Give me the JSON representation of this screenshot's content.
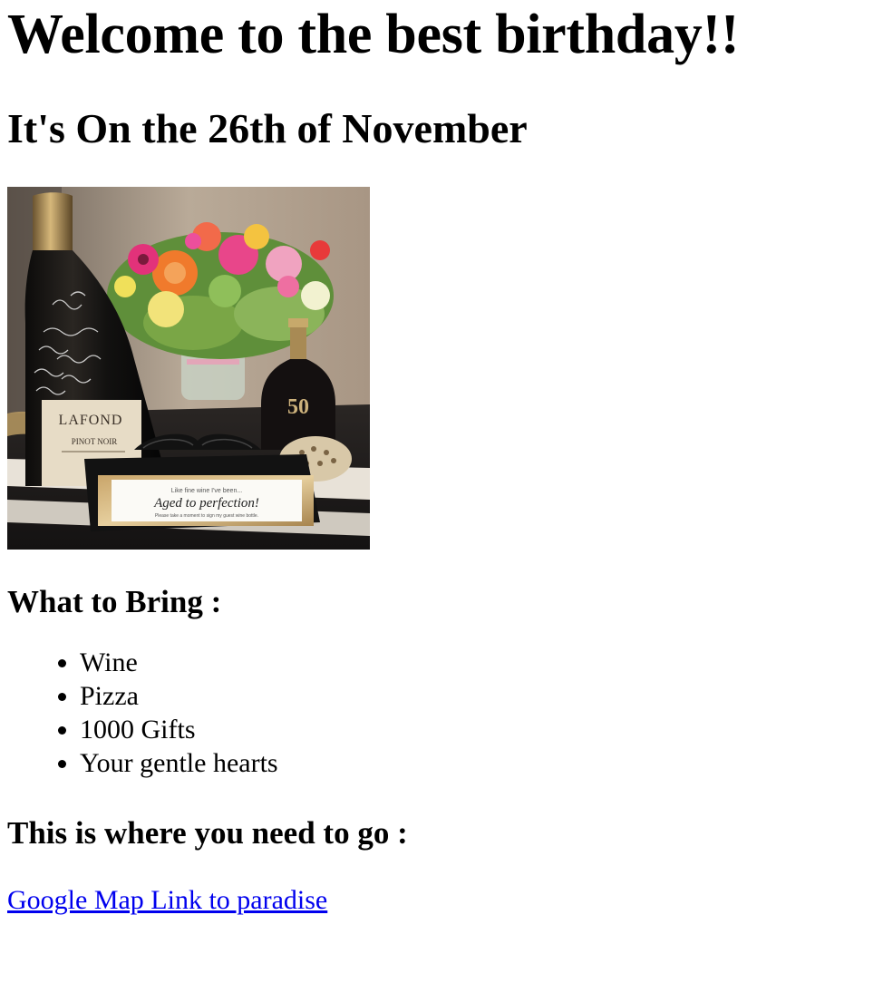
{
  "page": {
    "title": "Welcome to the best birthday!!",
    "date_heading": "It's On the 26th of November",
    "photo": {
      "bottle_label_brand": "LAFOND",
      "bottle_label_variety": "PINOT NOIR",
      "small_bottle_label": "50",
      "sign_top_line": "Like fine wine I've been...",
      "sign_main_line": "Aged to perfection!",
      "sign_bottom_line": "Please take a moment to sign my guest wine bottle."
    },
    "bring_heading": "What to Bring :",
    "bring_items": [
      "Wine",
      "Pizza",
      "1000 Gifts",
      "Your gentle hearts"
    ],
    "where_heading": "This is where you need to go :",
    "map_link_text": "Google Map Link to paradise"
  },
  "colors": {
    "link": "#0000ee",
    "text": "#000000",
    "background": "#ffffff"
  }
}
